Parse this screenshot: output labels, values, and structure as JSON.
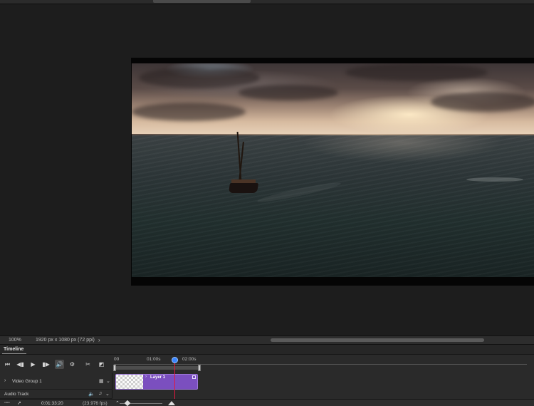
{
  "status": {
    "zoom": "100%",
    "doc_info": "1920 px x 1080 px (72 ppi)",
    "more_icon": "chevron-right-icon"
  },
  "timeline": {
    "title": "Timeline",
    "controls": {
      "first_frame": "⏮",
      "prev_frame": "◀▮",
      "play": "▶",
      "next_frame": "▮▶",
      "audio": "🔊",
      "settings": "⚙",
      "split": "✂",
      "transition": "◩"
    },
    "ruler": {
      "marks": [
        "00",
        "01:00s",
        "02:00s"
      ]
    },
    "layers": {
      "video_group": "Video Group 1",
      "audio_track": "Audio Track"
    },
    "clip": {
      "name": "Layer 1"
    },
    "current_time": "0:01:33:20",
    "fps": "(23.976 fps)"
  },
  "colors": {
    "clip": "#7b4fbf",
    "playhead": "#e3173e",
    "playhead_knob": "#3a86ff"
  }
}
